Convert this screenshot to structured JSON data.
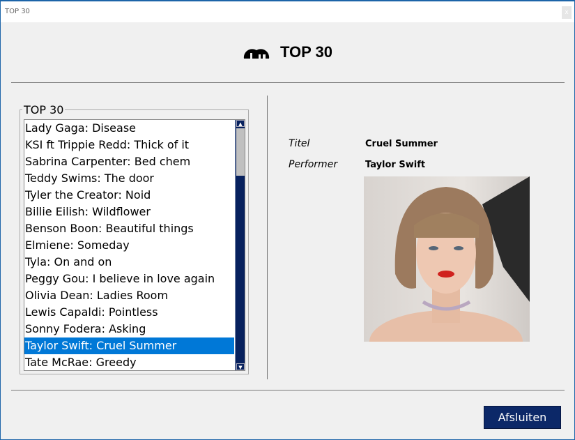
{
  "window": {
    "title": "TOP 30",
    "close_label": "x"
  },
  "header": {
    "title": "TOP 30",
    "logo_icon": "deviantart-like-logo"
  },
  "list": {
    "group_label": "TOP 30",
    "items": [
      "Lady Gaga: Disease",
      "KSI ft Trippie Redd: Thick of it",
      "Sabrina Carpenter: Bed chem",
      "Teddy Swims: The door",
      "Tyler the Creator: Noid",
      "Billie Eilish: Wildflower",
      "Benson Boon: Beautiful things",
      "Elmiene: Someday",
      "Tyla: On and on",
      "Peggy Gou: I believe in love again",
      "Olivia Dean: Ladies Room",
      "Lewis Capaldi: Pointless",
      "Sonny Fodera: Asking",
      "Taylor Swift: Cruel Summer",
      "Tate McRae: Greedy"
    ],
    "selected_index": 13
  },
  "details": {
    "title_label": "Titel",
    "title_value": "Cruel Summer",
    "performer_label": "Performer",
    "performer_value": "Taylor Swift"
  },
  "footer": {
    "close_button": "Afsluiten"
  },
  "colors": {
    "accent": "#0078d7",
    "button": "#0c2868",
    "scrollbar": "#07215e"
  }
}
